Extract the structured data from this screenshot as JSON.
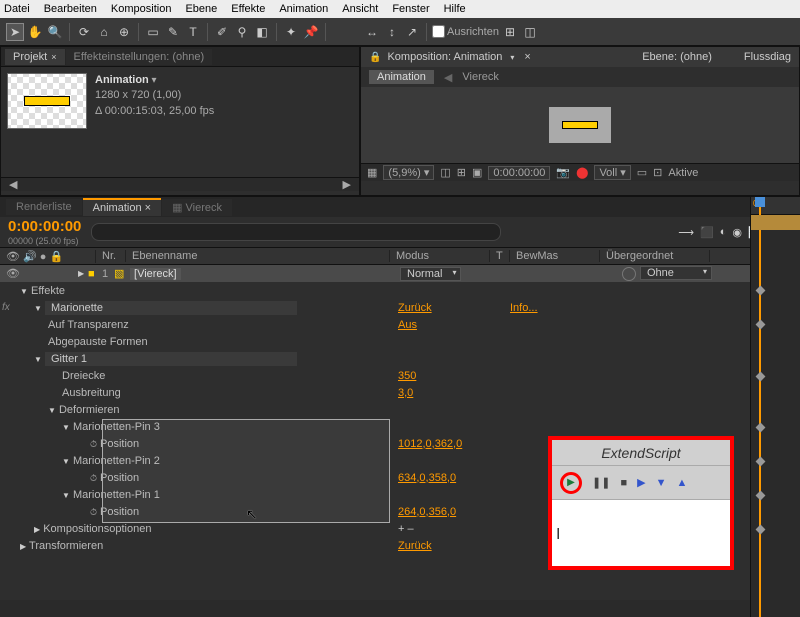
{
  "menu": [
    "Datei",
    "Bearbeiten",
    "Komposition",
    "Ebene",
    "Effekte",
    "Animation",
    "Ansicht",
    "Fenster",
    "Hilfe"
  ],
  "toolbar": {
    "ausrichten": "Ausrichten"
  },
  "project": {
    "tab": "Projekt",
    "effectsettings": "Effekteinstellungen: (ohne)",
    "comp_name": "Animation",
    "meta1": "1280 x 720 (1,00)",
    "meta2": "Δ 00:00:15:03, 25,00 fps"
  },
  "comp": {
    "panel_label": "Komposition: Animation",
    "ebene": "Ebene: (ohne)",
    "flussdiag": "Flussdiag",
    "crumb_active": "Animation",
    "crumb2": "Viereck",
    "zoom": "(5,9%)",
    "time": "0:00:00:00",
    "voll": "Voll",
    "aktive": "Aktive"
  },
  "tl": {
    "tab_renderliste": "Renderliste",
    "tab_anim": "Animation",
    "tab_viereck": "Viereck",
    "timecode": "0:00:00:00",
    "tc_sub": "00000 (25.00 fps)",
    "search_placeholder": "",
    "cols": {
      "nr": "Nr.",
      "ebenenname": "Ebenenname",
      "modus": "Modus",
      "t": "T",
      "bewmas": "BewMas",
      "parent": "Übergeordnet"
    },
    "layer1": {
      "num": "1",
      "name": "Viereck",
      "mode": "Normal",
      "parent": "Ohne"
    },
    "effekte": "Effekte",
    "marionette": "Marionette",
    "auf_transparenz": "Auf Transparenz",
    "abgepauste": "Abgepauste Formen",
    "gitter": "Gitter 1",
    "dreiecke": "Dreiecke",
    "ausbreitung": "Ausbreitung",
    "deformieren": "Deformieren",
    "pin3": "Marionetten-Pin 3",
    "pin2": "Marionetten-Pin 2",
    "pin1": "Marionetten-Pin 1",
    "position": "Position",
    "kompopt": "Kompositionsoptionen",
    "transform": "Transformieren",
    "vals": {
      "zuruck": "Zurück",
      "info": "Info...",
      "aus": "Aus",
      "dreiecke": "350",
      "ausbreitung": "3,0",
      "pos3": "1012,0,362,0",
      "pos2": "634,0,358,0",
      "pos1": "264,0,356,0",
      "plusminus": "+ –"
    }
  },
  "extend": {
    "title": "ExtendScript"
  }
}
